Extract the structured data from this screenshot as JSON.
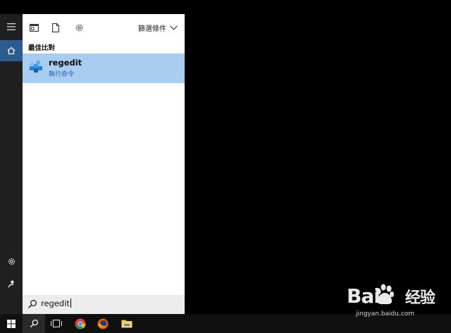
{
  "toolbar": {
    "filter_label": "篩選條件"
  },
  "results": {
    "section_label": "最佳比對",
    "best_match": {
      "title": "regedit",
      "subtitle": "執行命令"
    }
  },
  "search": {
    "value": "regedit"
  },
  "watermark": {
    "logo_text": "Bai",
    "brand_suffix": "经验",
    "url": "jingyan.baidu.com"
  },
  "colors": {
    "selection": "#a9cdf0",
    "rail_active": "#2b5b8f",
    "subtitle_blue": "#1a5fb0"
  }
}
